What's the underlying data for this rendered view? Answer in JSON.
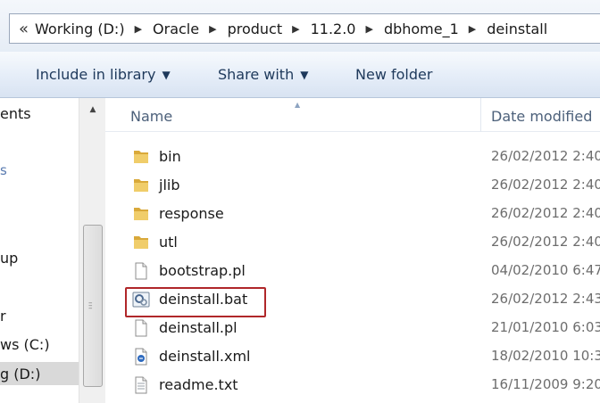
{
  "address": {
    "overflow": "«",
    "crumbs": [
      "Working (D:)",
      "Oracle",
      "product",
      "11.2.0",
      "dbhome_1",
      "deinstall"
    ],
    "separator": "▶"
  },
  "toolbar": {
    "include_label": "Include in library",
    "share_label": "Share with",
    "new_folder_label": "New folder",
    "caret": "▼"
  },
  "nav": {
    "items": [
      "ents",
      "s",
      "up",
      "r",
      "ws (C:)",
      "g (D:)"
    ],
    "selected": "g (D:)"
  },
  "columns": {
    "name": "Name",
    "date": "Date modified"
  },
  "files": [
    {
      "name": "bin",
      "date": "26/02/2012 2:40",
      "icon": "folder-icon"
    },
    {
      "name": "jlib",
      "date": "26/02/2012 2:40",
      "icon": "folder-icon"
    },
    {
      "name": "response",
      "date": "26/02/2012 2:40",
      "icon": "folder-icon"
    },
    {
      "name": "utl",
      "date": "26/02/2012 2:40",
      "icon": "folder-icon"
    },
    {
      "name": "bootstrap.pl",
      "date": "04/02/2010 6:47",
      "icon": "file-icon"
    },
    {
      "name": "deinstall.bat",
      "date": "26/02/2012 2:43",
      "icon": "batch-file-icon"
    },
    {
      "name": "deinstall.pl",
      "date": "21/01/2010 6:03",
      "icon": "file-icon"
    },
    {
      "name": "deinstall.xml",
      "date": "18/02/2010 10:3",
      "icon": "xml-file-icon"
    },
    {
      "name": "readme.txt",
      "date": "16/11/2009 9:20",
      "icon": "text-file-icon"
    }
  ],
  "colors": {
    "highlight": "#b0272a",
    "folder": "#e9c25c"
  }
}
